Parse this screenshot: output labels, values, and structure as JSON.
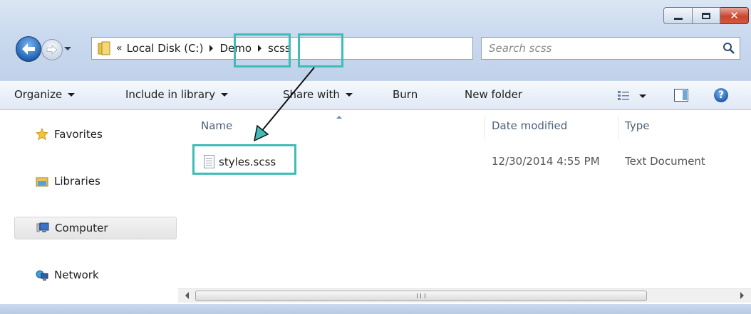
{
  "window": {
    "controls": {
      "minimize": "minimize",
      "maximize": "maximize",
      "close": "close"
    }
  },
  "navigation": {
    "back_icon": "back-arrow-icon",
    "forward_icon": "forward-arrow-icon"
  },
  "address_bar": {
    "chevron": "«",
    "crumbs": [
      "Local Disk (C:)",
      "Demo",
      "scss"
    ]
  },
  "search": {
    "placeholder": "Search scss"
  },
  "toolbar": {
    "organize": "Organize",
    "include_in_library": "Include in library",
    "share_with": "Share with",
    "burn": "Burn",
    "new_folder": "New folder"
  },
  "nav_pane": {
    "items": [
      {
        "label": "Favorites",
        "icon": "star-icon"
      },
      {
        "label": "Libraries",
        "icon": "libraries-icon"
      },
      {
        "label": "Computer",
        "icon": "computer-icon"
      },
      {
        "label": "Network",
        "icon": "network-icon"
      }
    ],
    "selected": "Computer"
  },
  "file_list": {
    "columns": [
      "Name",
      "Date modified",
      "Type"
    ],
    "rows": [
      {
        "name": "styles.scss",
        "date_modified": "12/30/2014 4:55 PM",
        "type": "Text Document"
      }
    ]
  },
  "annotation": {
    "highlight_color": "#3fbcb6",
    "arrow_color": "#111111"
  }
}
